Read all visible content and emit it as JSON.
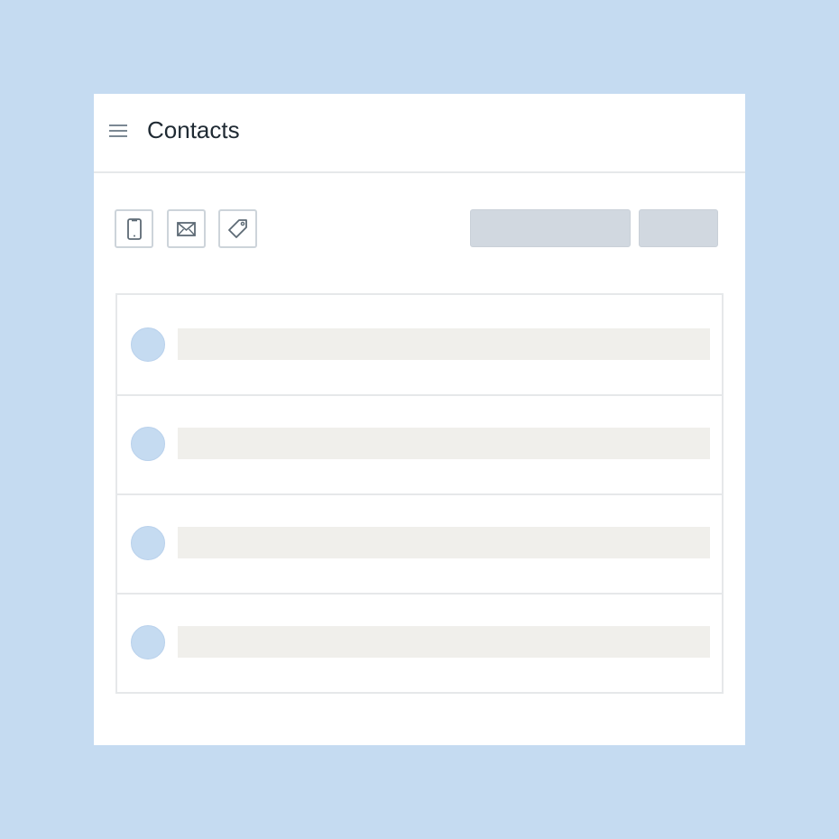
{
  "app": {
    "title": "Contacts"
  },
  "icons": {
    "menu": "hamburger-menu-icon",
    "phone": "mobile-phone-icon",
    "mail": "envelope-icon",
    "tag": "tag-icon"
  },
  "colors": {
    "background": "#c5dbf1",
    "card": "#ffffff",
    "avatar": "#c5dbf1",
    "placeholder_button": "#d1d8e0",
    "placeholder_text": "#f0efeb",
    "border": "#e6e8ea"
  },
  "contacts": [
    {
      "name": ""
    },
    {
      "name": ""
    },
    {
      "name": ""
    },
    {
      "name": ""
    }
  ]
}
